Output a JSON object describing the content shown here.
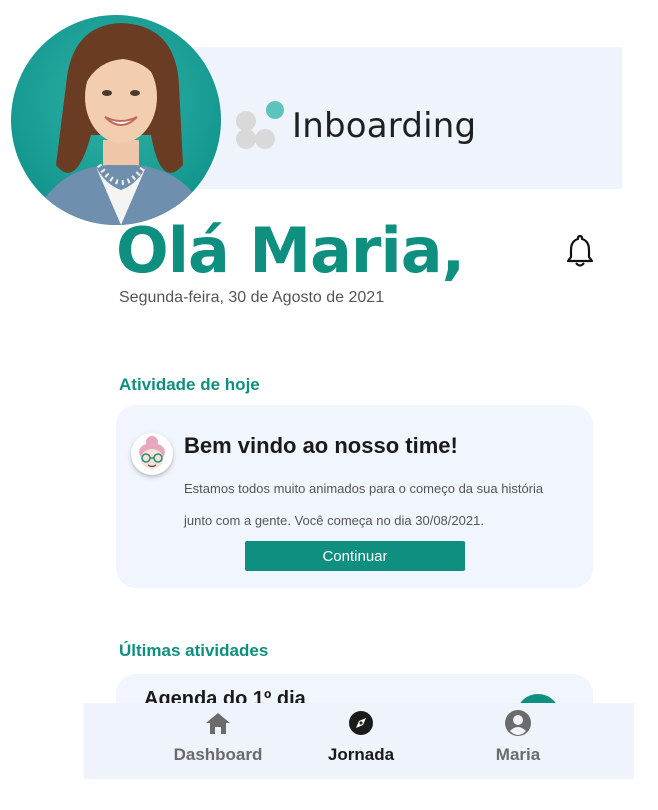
{
  "brand": {
    "name": "Inboarding"
  },
  "header": {
    "greeting": "Olá Maria,",
    "date": "Segunda-feira, 30 de Agosto de 2021"
  },
  "today": {
    "section_title": "Atividade de hoje",
    "card": {
      "title": "Bem vindo ao nosso time!",
      "text": "Estamos todos muito animados para o começo da sua história junto com a gente. Você começa no dia 30/08/2021.",
      "button_label": "Continuar"
    }
  },
  "recent": {
    "section_title": "Últimas atividades",
    "items": [
      {
        "title": "Agenda do 1º dia"
      }
    ]
  },
  "nav": {
    "items": [
      {
        "label": "Dashboard",
        "icon": "home-icon",
        "active": false
      },
      {
        "label": "Jornada",
        "icon": "compass-icon",
        "active": true
      },
      {
        "label": "Maria",
        "icon": "user-circle-icon",
        "active": false
      }
    ]
  },
  "colors": {
    "primary": "#0f8f80",
    "card_bg": "#f1f5fd",
    "accent_teal": "#5fc3bd"
  }
}
